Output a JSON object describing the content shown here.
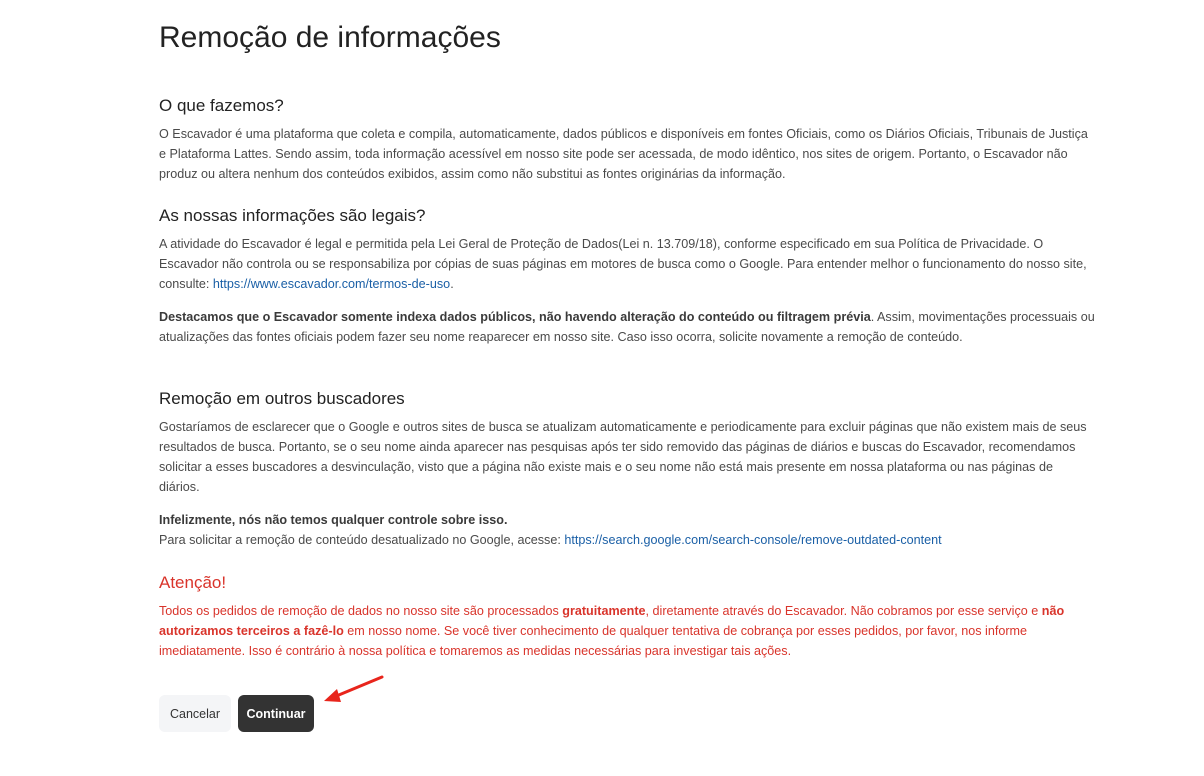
{
  "page": {
    "title": "Remoção de informações"
  },
  "sections": {
    "what_we_do": {
      "heading": "O que fazemos?",
      "text": "O Escavador é uma plataforma que coleta e compila, automaticamente, dados públicos e disponíveis em fontes Oficiais, como os Diários Oficiais, Tribunais de Justiça e Plataforma Lattes. Sendo assim, toda informação acessível em nosso site pode ser acessada, de modo idêntico, nos sites de origem. Portanto, o Escavador não produz ou altera nenhum dos conteúdos exibidos, assim como não substitui as fontes originárias da informação."
    },
    "legal": {
      "heading": "As nossas informações são legais?",
      "text_before_link": "A atividade do Escavador é legal e permitida pela Lei Geral de Proteção de Dados(Lei n. 13.709/18), conforme especificado em sua Política de Privacidade. O Escavador não controla ou se responsabiliza por cópias de suas páginas em motores de busca como o Google. Para entender melhor o funcionamento do nosso site, consulte: ",
      "link": "https://www.escavador.com/termos-de-uso",
      "text_after_link": ".",
      "bold": "Destacamos que o Escavador somente indexa dados públicos, não havendo alteração do conteúdo ou filtragem prévia",
      "bold_after": ". Assim, movimentações processuais ou atualizações das fontes oficiais podem fazer seu nome reaparecer em nosso site. Caso isso ocorra, solicite novamente a remoção de conteúdo."
    },
    "other_engines": {
      "heading": "Remoção em outros buscadores",
      "text": "Gostaríamos de esclarecer que o Google e outros sites de busca se atualizam automaticamente e periodicamente para excluir páginas que não existem mais de seus resultados de busca. Portanto, se o seu nome ainda aparecer nas pesquisas após ter sido removido das páginas de diários e buscas do Escavador, recomendamos solicitar a esses buscadores a desvinculação, visto que a página não existe mais e o seu nome não está mais presente em nossa plataforma ou nas páginas de diários.",
      "bold": "Infelizmente, nós não temos qualquer controle sobre isso.",
      "link_intro": "Para solicitar a remoção de conteúdo desatualizado no Google, acesse: ",
      "link": "https://search.google.com/search-console/remove-outdated-content"
    },
    "attention": {
      "heading": "Atenção!",
      "t1": "Todos os pedidos de remoção de dados no nosso site são processados ",
      "b1": "gratuitamente",
      "t2": ", diretamente através do Escavador. Não cobramos por esse serviço e ",
      "b2": "não autorizamos terceiros a fazê-lo",
      "t3": " em nosso nome. Se você tiver conhecimento de qualquer tentativa de cobrança por esses pedidos, por favor, nos informe imediatamente. Isso é contrário à nossa política e tomaremos as medidas necessárias para investigar tais ações."
    }
  },
  "buttons": {
    "cancel": "Cancelar",
    "continue": "Continuar"
  },
  "colors": {
    "accent_red": "#d9342b",
    "link": "#1a5fa6",
    "primary_button": "#333333"
  },
  "icons": {
    "annotation_arrow": "red-arrow-icon"
  }
}
